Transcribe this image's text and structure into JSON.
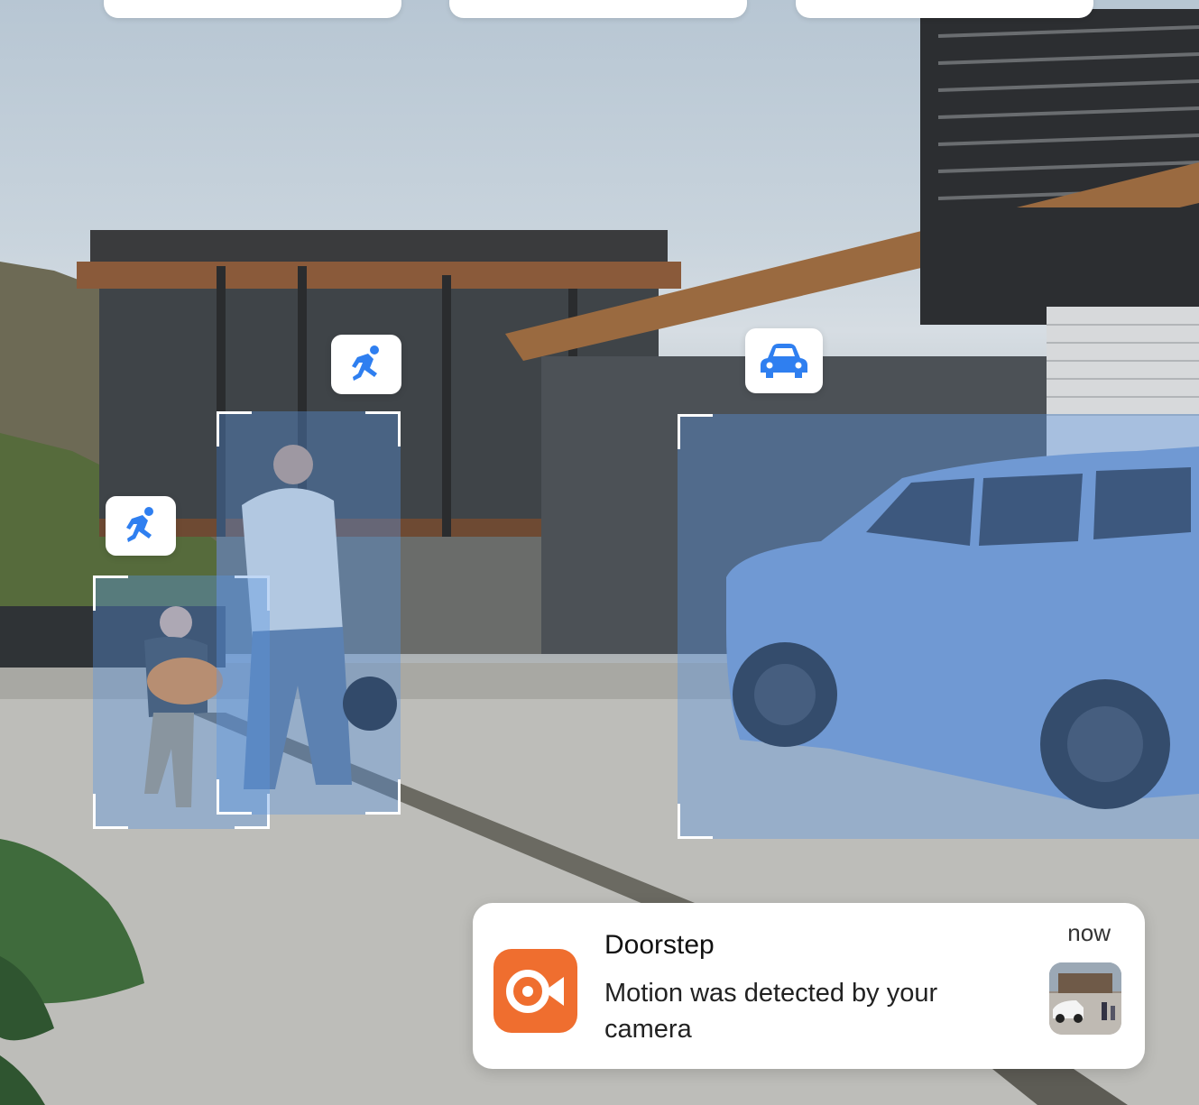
{
  "scene": {
    "description_icons": [
      "person-running-icon",
      "person-running-icon",
      "car-icon"
    ],
    "colors": {
      "box_fill": "#5a96e6",
      "icon_blue": "#2f7ff0",
      "app_orange": "#ef6e2f"
    }
  },
  "detections": [
    {
      "label_icon": "person-running-icon"
    },
    {
      "label_icon": "person-running-icon"
    },
    {
      "label_icon": "car-icon"
    }
  ],
  "notification": {
    "title": "Doorstep",
    "message": "Motion was detected by your camera",
    "time": "now",
    "app_icon": "camera-app-icon"
  }
}
